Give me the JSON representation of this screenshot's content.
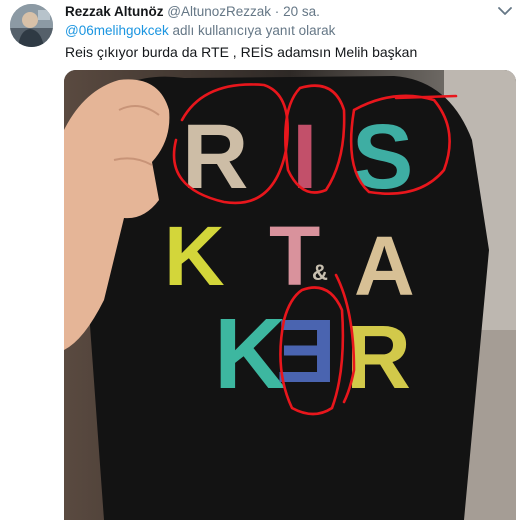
{
  "tweet": {
    "author_name": "Rezzak Altunöz",
    "author_handle": "@AltunozRezzak",
    "separator": "·",
    "timestamp": "20 sa.",
    "reply_to_mention": "@06melihgokcek",
    "reply_suffix": " adlı kullanıcıya yanıt olarak",
    "text": "Reis çıkıyor burda da RTE , REİS adamsın Melih başkan"
  },
  "media": {
    "shirt_letters": [
      "R",
      "I",
      "S",
      "K",
      "T",
      "A",
      "K",
      "E",
      "R"
    ],
    "shirt_ampersand": "&",
    "letter_colors": {
      "R_top": "#cdbda6",
      "I": "#c2506a",
      "S": "#3eaea3",
      "K_mid": "#d3d63a",
      "T": "#d9929c",
      "A": "#d7c095",
      "K_low": "#3db7a0",
      "E": "#4a64b0",
      "R_low": "#d2c94a"
    },
    "annotation_color": "#e8161c"
  },
  "icons": {
    "chevron": "chevron-down-icon"
  }
}
